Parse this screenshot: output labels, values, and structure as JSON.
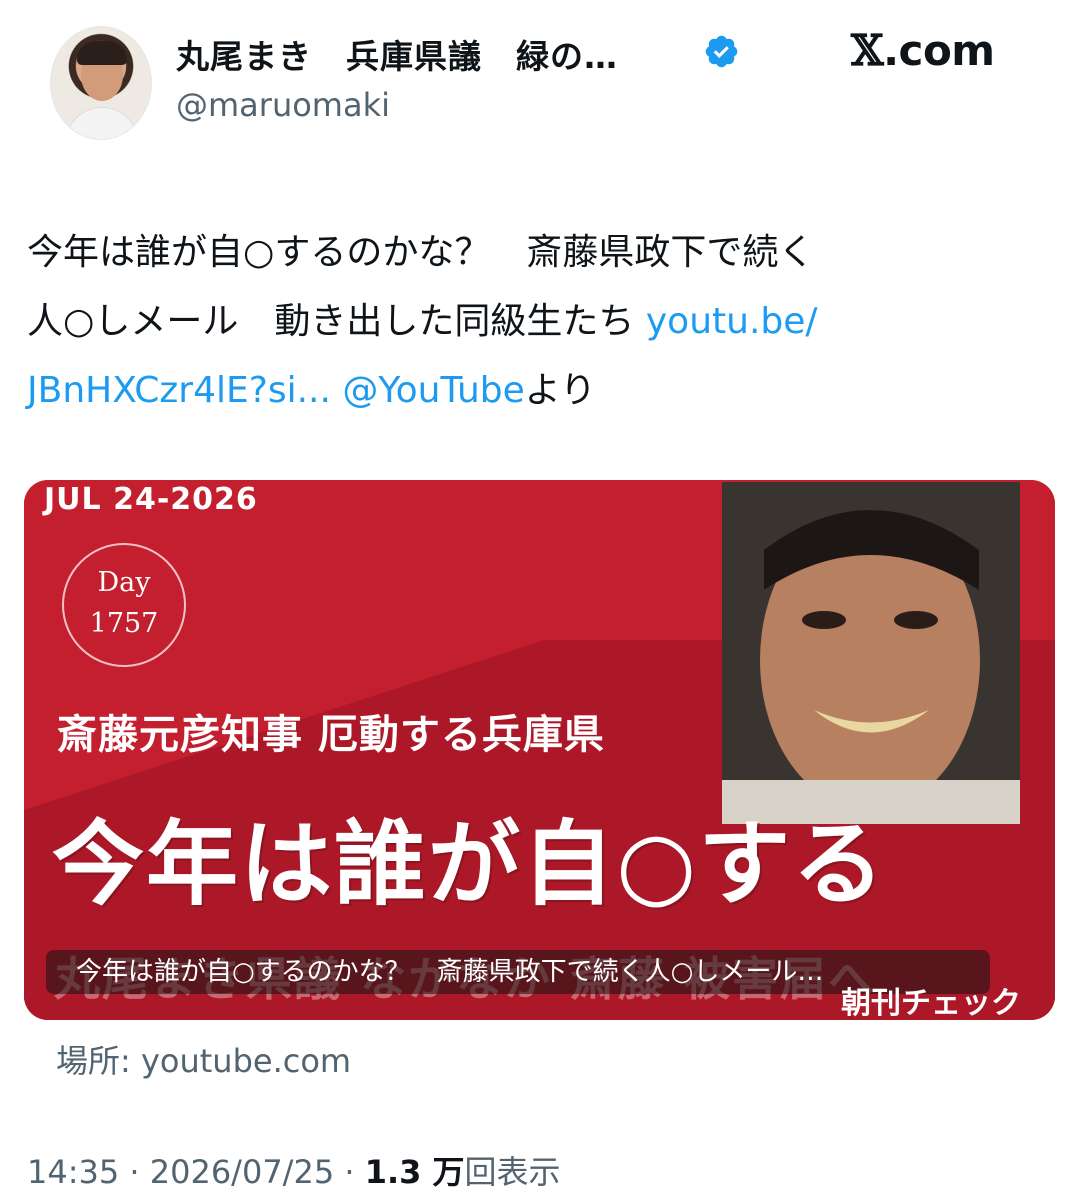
{
  "author": {
    "display_name": "丸尾まき　兵庫県議　緑の…",
    "handle": "@maruomaki",
    "verified": true
  },
  "brand": {
    "x_glyph": "𝕏",
    "domain": ".com"
  },
  "tweet": {
    "text_line1": "今年は誰が自○するのかな？　斎藤県政下で続く",
    "text_line2": "人○しメール　動き出した同級生たち ",
    "link_url_part1": "youtu.be/",
    "link_url_part2": "JBnHXCzr4lE?si...",
    "mention": "@YouTube",
    "mention_suffix": "より",
    "space": " "
  },
  "card": {
    "date": "JUL 24-2026",
    "day_label": "Day",
    "day_number": "1757",
    "subtitle": "斎藤元彦知事 厄動する兵庫県",
    "headline": "今年は誰が自○する",
    "ghost_text": "丸尾まき県議 なかなか 斎藤 被害届へ",
    "caption": "今年は誰が自○するのかな？　斎藤県政下で続く人○しメール…",
    "brand_label": "朝刊チェック",
    "source": "場所: youtube.com"
  },
  "meta": {
    "time": "14:35",
    "separator": " · ",
    "date": "2026/07/25",
    "views_number": "1.3 万",
    "views_label": "回表示"
  },
  "colors": {
    "card_red": "#c41f2e",
    "link_blue": "#1d9bf0",
    "secondary_text": "#536471"
  }
}
